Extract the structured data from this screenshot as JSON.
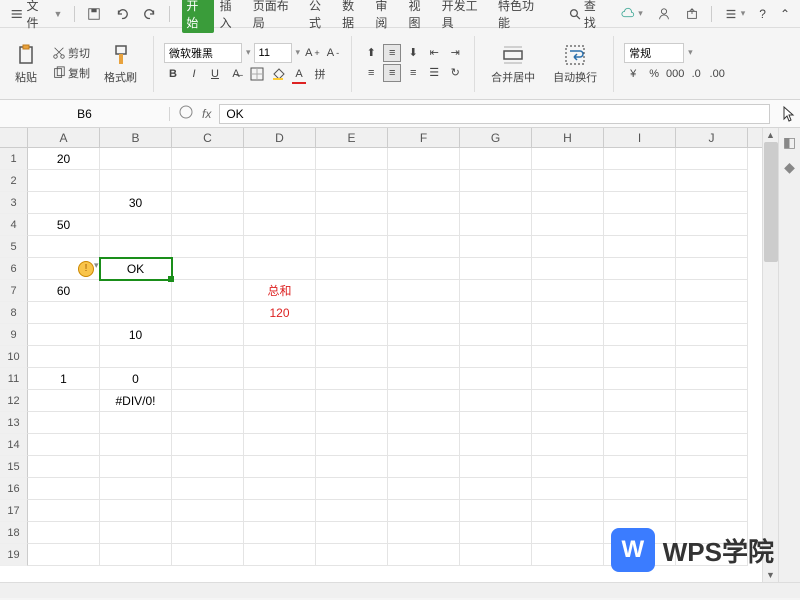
{
  "menubar": {
    "file": "文件",
    "tabs": [
      "开始",
      "插入",
      "页面布局",
      "公式",
      "数据",
      "审阅",
      "视图",
      "开发工具",
      "特色功能"
    ],
    "active_tab": 0,
    "search": "查找"
  },
  "ribbon": {
    "paste": "粘贴",
    "cut": "剪切",
    "copy": "复制",
    "format_painter": "格式刷",
    "font_name": "微软雅黑",
    "font_size": "11",
    "merge_center": "合并居中",
    "wrap_text": "自动换行",
    "number_format": "常规",
    "currency_sym": "¥",
    "percent_sym": "%",
    "thousand_sym": "000",
    "inc_dec": ".0",
    "dec_inc": ".00"
  },
  "formula_bar": {
    "cell_ref": "B6",
    "fx_label": "fx",
    "value": "OK"
  },
  "sheet": {
    "columns": [
      "A",
      "B",
      "C",
      "D",
      "E",
      "F",
      "G",
      "H",
      "I",
      "J"
    ],
    "rows": 19,
    "selected": {
      "row": 6,
      "col": "B"
    },
    "cells": {
      "A1": "20",
      "B3": "30",
      "A4": "50",
      "B6": "OK",
      "A7": "60",
      "D7": "总和",
      "D8": "120",
      "B9": "10",
      "A11": "1",
      "B11": "0",
      "B12": "#DIV/0!"
    },
    "red_cells": [
      "D7",
      "D8"
    ]
  },
  "watermark": {
    "logo": "W",
    "text": "WPS学院"
  }
}
